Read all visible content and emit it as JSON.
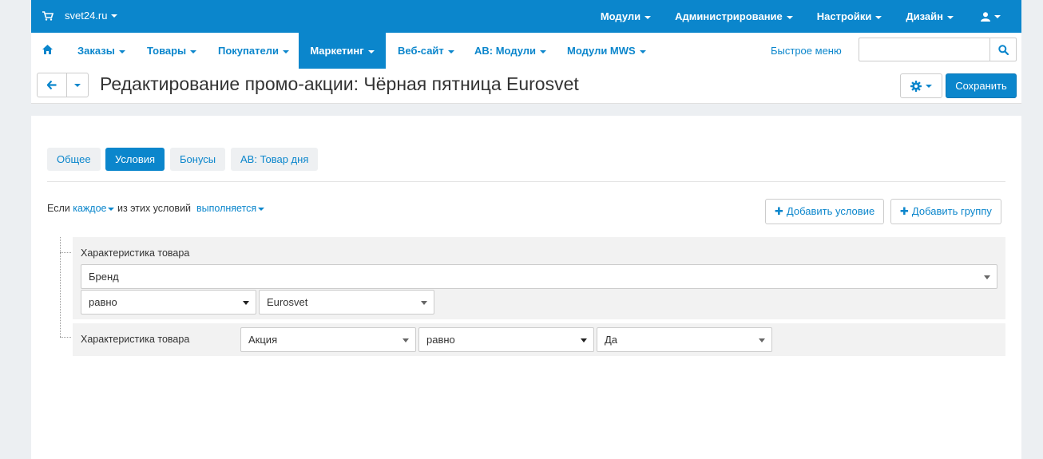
{
  "topbar": {
    "brand": "svet24.ru",
    "items": [
      {
        "label": "Модули"
      },
      {
        "label": "Администрирование"
      },
      {
        "label": "Настройки"
      },
      {
        "label": "Дизайн"
      }
    ]
  },
  "mainnav": {
    "items": [
      {
        "label": "Заказы"
      },
      {
        "label": "Товары"
      },
      {
        "label": "Покупатели"
      },
      {
        "label": "Маркетинг"
      },
      {
        "label": "Веб-сайт"
      },
      {
        "label": "AB: Модули"
      },
      {
        "label": "Модули MWS"
      }
    ],
    "quick_menu": "Быстрое меню",
    "search_placeholder": ""
  },
  "title": {
    "text": "Редактирование промо-акции: Чёрная пятница",
    "brand_part": "Eurosvet",
    "save_label": "Сохранить"
  },
  "tabs": [
    {
      "label": "Общее"
    },
    {
      "label": "Условия"
    },
    {
      "label": "Бонусы"
    },
    {
      "label": "AB: Товар дня"
    }
  ],
  "conditions": {
    "prefix": "Если",
    "mode": "каждое",
    "middle": "из этих условий",
    "state": "выполняется",
    "add_condition": "Добавить условие",
    "add_group": "Добавить группу",
    "rows": [
      {
        "label": "Характеристика товара",
        "feature": "Бренд",
        "operator": "равно",
        "value": "Eurosvet"
      },
      {
        "label": "Характеристика товара",
        "feature": "Акция",
        "operator": "равно",
        "value": "Да"
      }
    ]
  },
  "colors": {
    "accent": "#0b86cc",
    "background": "#eceff2"
  }
}
